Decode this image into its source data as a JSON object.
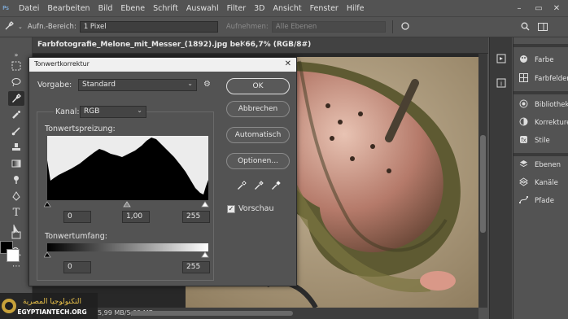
{
  "menu": {
    "logo": "Ps",
    "items": [
      "Datei",
      "Bearbeiten",
      "Bild",
      "Ebene",
      "Schrift",
      "Auswahl",
      "Filter",
      "3D",
      "Ansicht",
      "Fenster",
      "Hilfe"
    ]
  },
  "options_bar": {
    "sample_area_label": "Aufn.-Bereich:",
    "sample_area_value": "1 Pixel",
    "sample_label": "Aufnehmen:",
    "sample_value": "Alle Ebenen"
  },
  "document": {
    "tab_title": "Farbfotografie_Melone_mit_Messer_(1892).jpg bei 66,7% (RGB/8#)",
    "status_text": "5,99 MB/5,99 MB"
  },
  "panels": {
    "group1": [
      "Farbe",
      "Farbfelder"
    ],
    "group2": [
      "Bibliotheken",
      "Korrekturen",
      "Stile"
    ],
    "group3": [
      "Ebenen",
      "Kanäle",
      "Pfade"
    ]
  },
  "dialog": {
    "title": "Tonwertkorrektur",
    "preset_label": "Vorgabe:",
    "preset_value": "Standard",
    "channel_label": "Kanal:",
    "channel_value": "RGB",
    "input_levels_label": "Tonwertspreizung:",
    "input_black": "0",
    "input_gamma": "1,00",
    "input_white": "255",
    "output_levels_label": "Tonwertumfang:",
    "output_black": "0",
    "output_white": "255",
    "buttons": {
      "ok": "OK",
      "cancel": "Abbrechen",
      "auto": "Automatisch",
      "options": "Optionen..."
    },
    "preview_label": "Vorschau",
    "preview_checked": true
  },
  "watermark": {
    "line1": "التكنولوجيا المصرية",
    "line2": "EGYPTIANTECH.ORG"
  },
  "colors": {
    "ui_bg": "#535353",
    "dark_bg": "#282828",
    "panel_strip": "#3a3a3a",
    "accent_blue": "#31a8ff"
  }
}
